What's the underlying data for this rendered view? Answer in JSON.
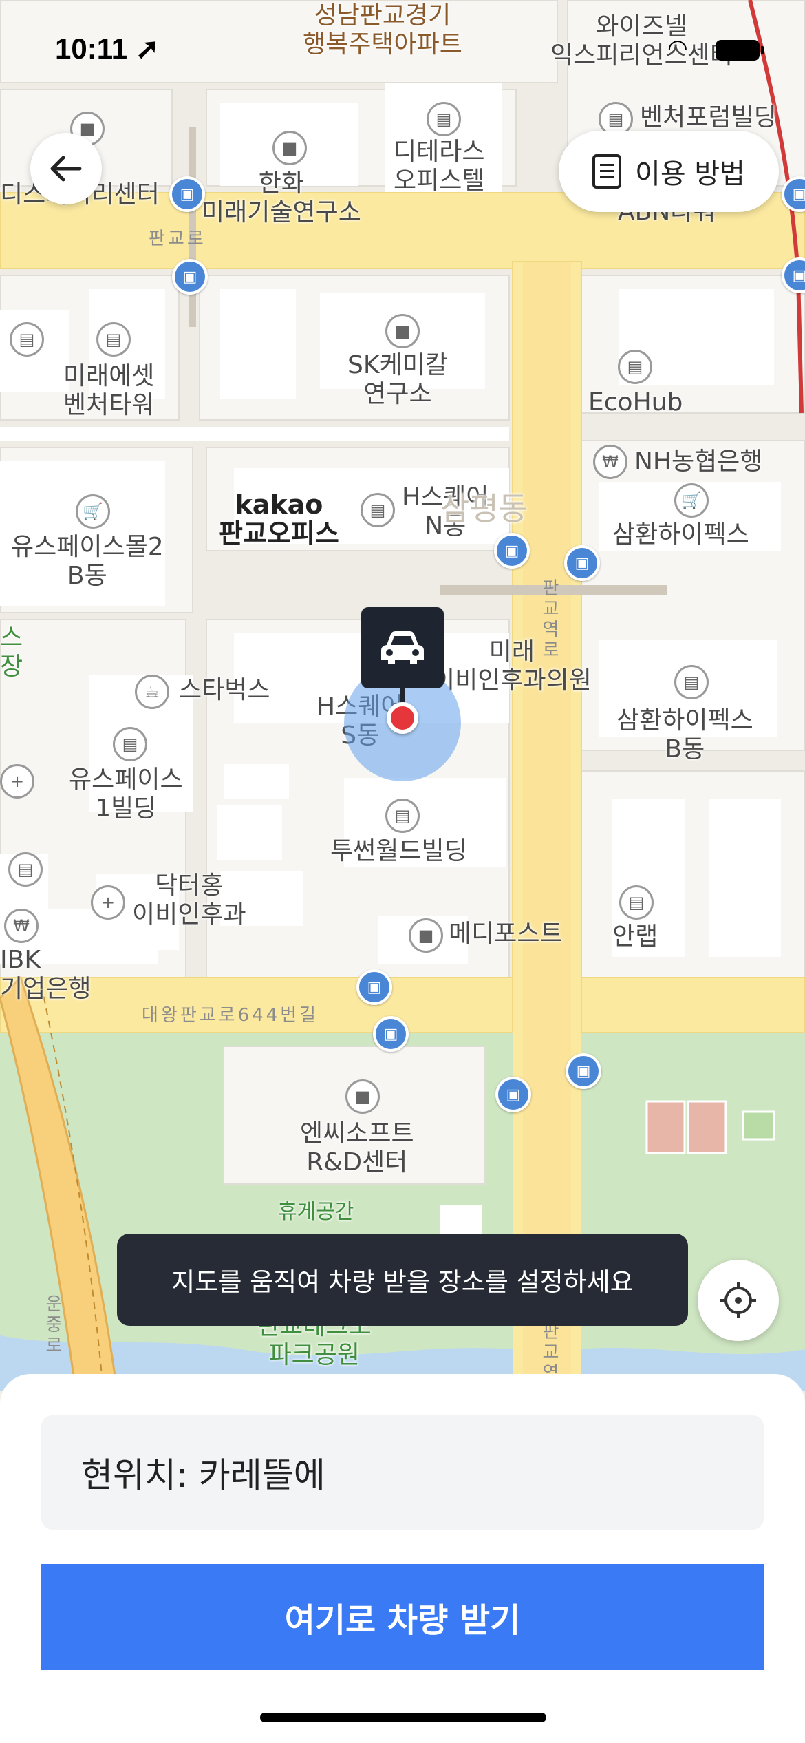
{
  "status_bar": {
    "time": "10:11 ➚"
  },
  "map": {
    "labels": [
      {
        "text": "성남판교경기\n행복주택아파트",
        "style": "brown"
      },
      {
        "text": "와이즈넬\n익스피리언스센터",
        "style": ""
      },
      {
        "text": "벤처포럼빌딩",
        "style": ""
      },
      {
        "text": "디테라스\n오피스텔",
        "style": ""
      },
      {
        "text": "한화\n미래기술연구소",
        "style": ""
      },
      {
        "text": "디스커버리센터",
        "style": ""
      },
      {
        "text": "ABN타워",
        "style": ""
      },
      {
        "text": "미래에셋\n벤처타워",
        "style": ""
      },
      {
        "text": "SK케미칼\n연구소",
        "style": ""
      },
      {
        "text": "EcoHub",
        "style": ""
      },
      {
        "text": "NH농협은행",
        "style": ""
      },
      {
        "text": "삼환하이펙스",
        "style": ""
      },
      {
        "text": "유스페이스몰2\nB동",
        "style": ""
      },
      {
        "text": "kakao\n판교오피스",
        "style": "bold"
      },
      {
        "text": "H스퀘어\nN동",
        "style": ""
      },
      {
        "text": "삼평동",
        "style": "faint"
      },
      {
        "text": "스타벅스",
        "style": ""
      },
      {
        "text": "H스퀘어\nS동",
        "style": ""
      },
      {
        "text": "미래\n이비인후과의원",
        "style": ""
      },
      {
        "text": "삼환하이펙스\nB동",
        "style": ""
      },
      {
        "text": "유스페이스\n1빌딩",
        "style": ""
      },
      {
        "text": "투썬월드빌딩",
        "style": ""
      },
      {
        "text": "닥터홍\n이비인후과",
        "style": ""
      },
      {
        "text": "메디포스트",
        "style": ""
      },
      {
        "text": "안랩",
        "style": ""
      },
      {
        "text": "IBK\n기업은행",
        "style": ""
      },
      {
        "text": "엔씨소프트\nR&D센터",
        "style": ""
      },
      {
        "text": "휴게공간",
        "style": "green"
      },
      {
        "text": "판교테크노\n파크공원",
        "style": "green"
      },
      {
        "text": "스\n장",
        "style": "green"
      }
    ],
    "roads": [
      "판교로",
      "대왕판교로644번길",
      "판교역로",
      "운중로",
      "판교역로"
    ]
  },
  "header": {
    "back_icon": "arrow-left-icon",
    "how_to_label": "이용 방법"
  },
  "pin": {
    "icon": "car-icon"
  },
  "toast": {
    "message": "지도를 움직여 차량 받을 장소를 설정하세요"
  },
  "sheet": {
    "location_value": "현위치: 카레뜰에",
    "cta_label": "여기로 차량 받기"
  },
  "colors": {
    "accent": "#3a7bf5",
    "pin_red": "#e5363b",
    "road_yellow": "#fbe9a0",
    "park_green": "#cfe6c3"
  }
}
